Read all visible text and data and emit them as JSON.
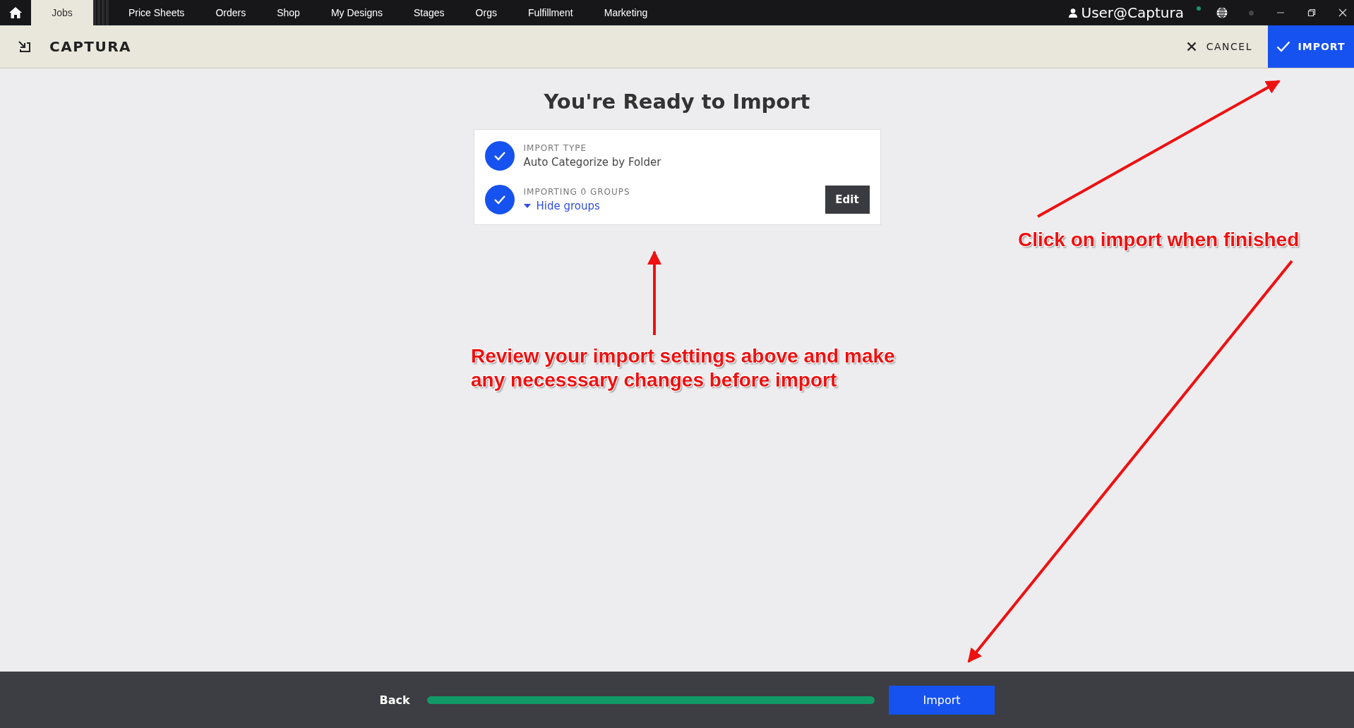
{
  "nav": {
    "tabs": [
      {
        "label": "Jobs",
        "selected": true
      },
      {
        "label": "Price Sheets",
        "selected": false
      },
      {
        "label": "Orders",
        "selected": false
      },
      {
        "label": "Shop",
        "selected": false
      },
      {
        "label": "My Designs",
        "selected": false
      },
      {
        "label": "Stages",
        "selected": false
      },
      {
        "label": "Orgs",
        "selected": false
      },
      {
        "label": "Fulfillment",
        "selected": false
      },
      {
        "label": "Marketing",
        "selected": false
      }
    ],
    "user": "User@Captura"
  },
  "header": {
    "title": "CAPTURA",
    "cancel": "CANCEL",
    "import": "IMPORT"
  },
  "main": {
    "heading": "You're Ready to Import",
    "steps": [
      {
        "label": "IMPORT TYPE",
        "value": "Auto Categorize by Folder",
        "checked": true,
        "kind": "text"
      },
      {
        "label": "IMPORTING 0 GROUPS",
        "value": "Hide groups",
        "checked": true,
        "kind": "toggle",
        "expanded": true,
        "action": "Edit"
      }
    ]
  },
  "footer": {
    "back": "Back",
    "progress": {
      "level": 1.0
    },
    "next": "Import"
  },
  "annotations": [
    {
      "text": "Click on import when finished",
      "kind": "right"
    },
    {
      "text": "Review your import settings above and make any necesssary changes before import",
      "kind": "center"
    }
  ]
}
